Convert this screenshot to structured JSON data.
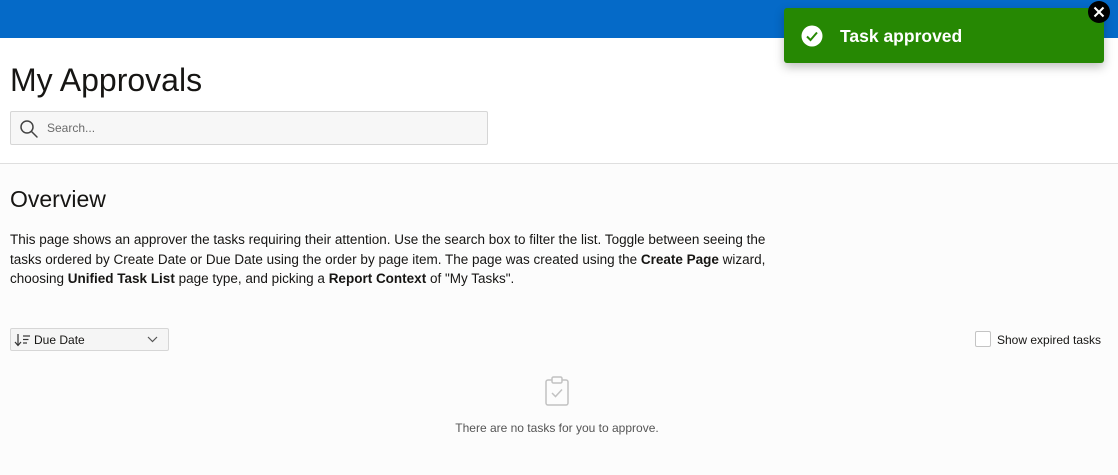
{
  "colors": {
    "header_bar": "#056ac8",
    "toast_bg": "#268803",
    "toast_text": "#ffffff"
  },
  "header": {
    "title": "My Approvals",
    "search": {
      "placeholder": "Search...",
      "value": "",
      "icon": "search-icon"
    }
  },
  "overview": {
    "title": "Overview",
    "paragraph": {
      "part1": "This page shows an approver the tasks requiring their attention. Use the search box to filter the list. Toggle between seeing the tasks ordered by Create Date or Due Date using the order by page item. The page was created using the ",
      "bold1": "Create Page",
      "part2": " wizard, choosing ",
      "bold2": "Unified Task List",
      "part3": " page type, and picking a ",
      "bold3": "Report Context",
      "part4": " of \"My Tasks\"."
    }
  },
  "toolbar": {
    "sort": {
      "selected": "Due Date",
      "icon": "sort-descending-icon",
      "chevron": "chevron-down-icon"
    },
    "show_expired": {
      "label": "Show expired tasks",
      "checked": false
    }
  },
  "empty_state": {
    "icon": "clipboard-check-icon",
    "message": "There are no tasks for you to approve."
  },
  "toast": {
    "message": "Task approved",
    "icon": "check-circle-icon",
    "close_icon": "close-icon"
  }
}
